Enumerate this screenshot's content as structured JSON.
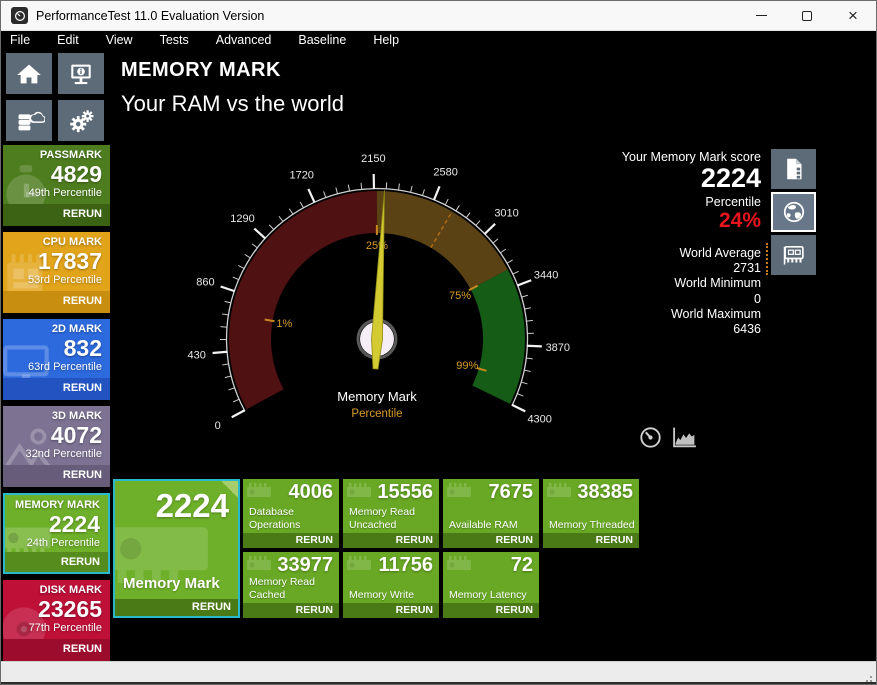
{
  "window": {
    "title": "PerformanceTest 11.0 Evaluation Version"
  },
  "menu": {
    "items": [
      "File",
      "Edit",
      "View",
      "Tests",
      "Advanced",
      "Baseline",
      "Help"
    ]
  },
  "header": {
    "title": "MEMORY MARK",
    "subtitle": "Your RAM vs the world"
  },
  "sidebar": {
    "tiles": [
      {
        "label": "PASSMARK",
        "value": "4829",
        "percentile": "49th Percentile",
        "action": "RERUN",
        "color": "#4e7d1f",
        "footer_color": "#3c6314",
        "icon": "stopwatch"
      },
      {
        "label": "CPU MARK",
        "value": "17837",
        "percentile": "53rd Percentile",
        "action": "RERUN",
        "color": "#e2a41a",
        "footer_color": "#c78e10",
        "icon": "cpu-chip"
      },
      {
        "label": "2D MARK",
        "value": "832",
        "percentile": "63rd Percentile",
        "action": "RERUN",
        "color": "#2d6ade",
        "footer_color": "#2353c0",
        "icon": "monitor"
      },
      {
        "label": "3D MARK",
        "value": "4072",
        "percentile": "32nd Percentile",
        "action": "RERUN",
        "color": "#7d7292",
        "footer_color": "#675d7a",
        "icon": "mountains"
      },
      {
        "label": "MEMORY MARK",
        "value": "2224",
        "percentile": "24th Percentile",
        "action": "RERUN",
        "color": "#6fb02a",
        "footer_color": "#568c1e",
        "icon": "ram-stick",
        "selected": true
      },
      {
        "label": "DISK MARK",
        "value": "23265",
        "percentile": "77th Percentile",
        "action": "RERUN",
        "color": "#bf1038",
        "footer_color": "#9c0c2c",
        "icon": "disk"
      }
    ]
  },
  "gauge": {
    "type": "gauge",
    "min": 0,
    "max": 4300,
    "value": 2224,
    "tick_step": 86,
    "major_tick_step": 430,
    "tick_labels": [
      0,
      430,
      860,
      1290,
      1720,
      2150,
      2580,
      3010,
      3440,
      3870,
      4300
    ],
    "segments": [
      {
        "from": 0,
        "to": 2170,
        "color": "#4f1111"
      },
      {
        "from": 2170,
        "to": 3310,
        "color": "#5a4214"
      },
      {
        "from": 3310,
        "to": 4300,
        "color": "#155c17"
      }
    ],
    "percentile_marks": [
      {
        "label": "1%",
        "value": 700
      },
      {
        "label": "25%",
        "value": 2170
      },
      {
        "label": "75%",
        "value": 3310
      },
      {
        "label": "99%",
        "value": 4120
      }
    ],
    "world_average_marker": 2731,
    "needle_color": "#d3cb31",
    "caption": "Memory Mark",
    "sub_caption": "Percentile"
  },
  "score_panel": {
    "score_label": "Your Memory Mark score",
    "score": "2224",
    "percentile_label": "Percentile",
    "percentile": "24%",
    "stats": [
      {
        "label": "World Average",
        "value": "2731"
      },
      {
        "label": "World Minimum",
        "value": "0"
      },
      {
        "label": "World Maximum",
        "value": "6436"
      }
    ]
  },
  "results": {
    "main_tile": {
      "value": "2224",
      "label": "Memory Mark",
      "action": "RERUN"
    },
    "tiles": [
      {
        "value": "4006",
        "label": "Database Operations",
        "action": "RERUN"
      },
      {
        "value": "15556",
        "label": "Memory Read Uncached",
        "action": "RERUN"
      },
      {
        "value": "7675",
        "label": "Available RAM",
        "action": "RERUN"
      },
      {
        "value": "38385",
        "label": "Memory Threaded",
        "action": "RERUN"
      },
      {
        "value": "33977",
        "label": "Memory Read Cached",
        "action": "RERUN"
      },
      {
        "value": "11756",
        "label": "Memory Write",
        "action": "RERUN"
      },
      {
        "value": "72",
        "label": "Memory Latency",
        "action": "RERUN"
      }
    ]
  },
  "colors": {
    "selected_border_cyan": "#29b9cd",
    "percentile_red": "#e8141e",
    "gauge_orange": "#d99c28",
    "result_green": "#68a824",
    "result_green_dark": "#4a7a16",
    "nav_slate": "#5d6b79"
  }
}
